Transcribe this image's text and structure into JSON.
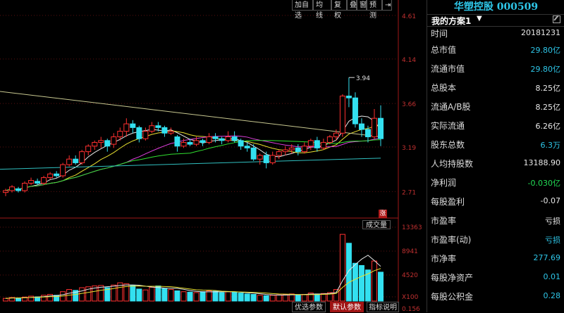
{
  "toolbar": {
    "buttons": [
      "加自选",
      "均线",
      "复权",
      "叠",
      "窗",
      "预测"
    ],
    "pin_icon": "pin-icon"
  },
  "stock": {
    "name_code": "华塑控股 000509"
  },
  "plan": {
    "name": "我的方案1"
  },
  "fields": [
    {
      "label": "时间",
      "value": "20181231",
      "color": "white"
    },
    {
      "label": "总市值",
      "value": "29.80亿",
      "color": "cyan"
    },
    {
      "label": "流通市值",
      "value": "29.80亿",
      "color": "cyan"
    },
    {
      "label": "总股本",
      "value": "8.25亿",
      "color": "white"
    },
    {
      "label": "流通A/B股",
      "value": "8.25亿",
      "color": "white"
    },
    {
      "label": "实际流通",
      "value": "6.26亿",
      "color": "white"
    },
    {
      "label": "股东总数",
      "value": "6.3万",
      "color": "cyan"
    },
    {
      "label": "人均持股数",
      "value": "13188.90",
      "color": "white"
    },
    {
      "label": "净利润",
      "value": "-0.030亿",
      "color": "green"
    },
    {
      "label": "每股盈利",
      "value": "-0.07",
      "color": "white"
    },
    {
      "label": "市盈率",
      "value": "亏损",
      "color": "white"
    },
    {
      "label": "市盈率(动)",
      "value": "亏损",
      "color": "cyan"
    },
    {
      "label": "市净率",
      "value": "277.69",
      "color": "cyan"
    },
    {
      "label": "每股净资产",
      "value": "0.01",
      "color": "cyan"
    },
    {
      "label": "每股公积金",
      "value": "0.28",
      "color": "cyan"
    }
  ],
  "price_axis": [
    "4.61",
    "4.14",
    "3.66",
    "3.19",
    "2.71"
  ],
  "high_label": "3.94",
  "volume": {
    "label": "成交量",
    "axis": [
      "13363",
      "8941",
      "4520",
      "X100"
    ],
    "bottom_partial": "0.156"
  },
  "badge": "涨",
  "bottom_tabs": [
    {
      "label": "优选参数",
      "active": false
    },
    {
      "label": "默认参数",
      "active": true
    },
    {
      "label": "指标说明",
      "active": false
    }
  ],
  "colors": {
    "up": "#ff3030",
    "down": "#33e0f0",
    "ma5": "#e8e8e8",
    "ma10": "#e8e030",
    "ma20": "#e040e0",
    "ma30": "#30e030",
    "ma60": "#30c0c0",
    "ma120": "#c8c890"
  },
  "chart_data": {
    "type": "candlestick",
    "ylim": [
      2.5,
      4.7
    ],
    "candles": [
      [
        2.7,
        2.72,
        2.66,
        2.74
      ],
      [
        2.72,
        2.76,
        2.7,
        2.78
      ],
      [
        2.74,
        2.72,
        2.7,
        2.76
      ],
      [
        2.72,
        2.8,
        2.7,
        2.82
      ],
      [
        2.8,
        2.83,
        2.78,
        2.86
      ],
      [
        2.82,
        2.8,
        2.78,
        2.85
      ],
      [
        2.8,
        2.86,
        2.78,
        2.88
      ],
      [
        2.86,
        2.9,
        2.84,
        2.92
      ],
      [
        2.9,
        2.88,
        2.86,
        2.93
      ],
      [
        2.88,
        3.0,
        2.86,
        3.02
      ],
      [
        3.0,
        3.06,
        2.98,
        3.1
      ],
      [
        3.06,
        3.02,
        3.0,
        3.1
      ],
      [
        3.02,
        3.14,
        3.0,
        3.16
      ],
      [
        3.14,
        3.2,
        3.1,
        3.22
      ],
      [
        3.2,
        3.24,
        3.16,
        3.26
      ],
      [
        3.24,
        3.26,
        3.18,
        3.3
      ],
      [
        3.26,
        3.2,
        3.14,
        3.28
      ],
      [
        3.22,
        3.3,
        3.18,
        3.34
      ],
      [
        3.3,
        3.36,
        3.26,
        3.4
      ],
      [
        3.36,
        3.44,
        3.3,
        3.5
      ],
      [
        3.44,
        3.4,
        3.34,
        3.48
      ],
      [
        3.4,
        3.28,
        3.24,
        3.42
      ],
      [
        3.28,
        3.36,
        3.26,
        3.4
      ],
      [
        3.36,
        3.42,
        3.34,
        3.46
      ],
      [
        3.42,
        3.4,
        3.36,
        3.46
      ],
      [
        3.4,
        3.34,
        3.3,
        3.42
      ],
      [
        3.34,
        3.36,
        3.32,
        3.4
      ],
      [
        3.3,
        3.2,
        3.14,
        3.32
      ],
      [
        3.2,
        3.24,
        3.18,
        3.28
      ],
      [
        3.24,
        3.22,
        3.2,
        3.28
      ],
      [
        3.22,
        3.26,
        3.2,
        3.3
      ],
      [
        3.26,
        3.24,
        3.2,
        3.28
      ],
      [
        3.24,
        3.3,
        3.22,
        3.34
      ],
      [
        3.3,
        3.28,
        3.24,
        3.34
      ],
      [
        3.28,
        3.26,
        3.22,
        3.3
      ],
      [
        3.26,
        3.3,
        3.24,
        3.36
      ],
      [
        3.3,
        3.26,
        3.24,
        3.36
      ],
      [
        3.26,
        3.2,
        3.16,
        3.28
      ],
      [
        3.2,
        3.18,
        3.14,
        3.24
      ],
      [
        3.18,
        3.06,
        3.04,
        3.22
      ],
      [
        3.06,
        3.1,
        3.0,
        3.12
      ],
      [
        3.1,
        3.02,
        2.96,
        3.14
      ],
      [
        3.02,
        3.1,
        3.0,
        3.14
      ],
      [
        3.1,
        3.14,
        3.06,
        3.16
      ],
      [
        3.14,
        3.16,
        3.1,
        3.2
      ],
      [
        3.16,
        3.18,
        3.12,
        3.22
      ],
      [
        3.18,
        3.14,
        3.1,
        3.22
      ],
      [
        3.14,
        3.2,
        3.12,
        3.24
      ],
      [
        3.2,
        3.26,
        3.16,
        3.28
      ],
      [
        3.26,
        3.18,
        3.14,
        3.3
      ],
      [
        3.18,
        3.24,
        3.16,
        3.28
      ],
      [
        3.24,
        3.3,
        3.22,
        3.32
      ],
      [
        3.3,
        3.34,
        3.26,
        3.38
      ],
      [
        3.34,
        3.74,
        3.3,
        3.76
      ],
      [
        3.74,
        3.72,
        3.62,
        3.94
      ],
      [
        3.72,
        3.44,
        3.4,
        3.78
      ],
      [
        3.44,
        3.38,
        3.3,
        3.5
      ],
      [
        3.38,
        3.3,
        3.24,
        3.42
      ],
      [
        3.3,
        3.5,
        3.28,
        3.6
      ],
      [
        3.5,
        3.28,
        3.2,
        3.64
      ]
    ],
    "volumes": [
      120,
      160,
      140,
      180,
      220,
      190,
      260,
      300,
      260,
      420,
      520,
      480,
      600,
      640,
      680,
      700,
      600,
      720,
      820,
      780,
      700,
      540,
      500,
      620,
      680,
      560,
      520,
      460,
      420,
      400,
      380,
      420,
      460,
      440,
      380,
      420,
      400,
      360,
      320,
      300,
      260,
      240,
      260,
      280,
      300,
      320,
      280,
      300,
      360,
      320,
      340,
      380,
      520,
      3000,
      2600,
      1700,
      1600,
      1400,
      1800,
      1300
    ]
  }
}
